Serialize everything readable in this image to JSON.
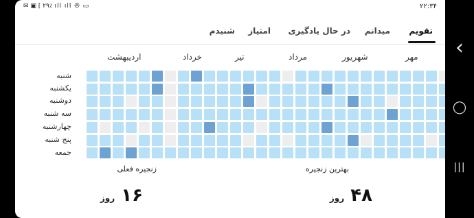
{
  "status": {
    "time": "۲۲:۳۴",
    "icons": "✉ ▣ ⁅ ۲۹٪ ıll ıll ✇ ▭"
  },
  "tabs": [
    {
      "label": "تقویم",
      "active": true
    },
    {
      "label": "میدانم",
      "active": false
    },
    {
      "label": "در حال یادگیری",
      "active": false
    },
    {
      "label": "امتیاز",
      "active": false
    },
    {
      "label": "شنیدم",
      "active": false
    }
  ],
  "months": [
    "مهر",
    "شهریور",
    "مرداد",
    "تیر",
    "خرداد",
    "اردیبهشت"
  ],
  "weekdays": [
    "شنبه",
    "یکشنبه",
    "دوشنبه",
    "سه شنبه",
    "چهارشنبه",
    "پنج شنبه",
    "جمعه"
  ],
  "activity_grid": [
    [
      1,
      1,
      1,
      1,
      1,
      3,
      0,
      1,
      3,
      1,
      1,
      1,
      1,
      1,
      1,
      0,
      1,
      1,
      1,
      1,
      1,
      1,
      1,
      1,
      1,
      1,
      1,
      0,
      1,
      1,
      1,
      1
    ],
    [
      1,
      1,
      1,
      1,
      1,
      3,
      0,
      1,
      1,
      1,
      1,
      1,
      3,
      1,
      1,
      1,
      1,
      1,
      3,
      1,
      1,
      1,
      1,
      1,
      1,
      1,
      1,
      1,
      1,
      1,
      1,
      0
    ],
    [
      1,
      1,
      1,
      0,
      1,
      1,
      0,
      1,
      1,
      1,
      1,
      1,
      3,
      0,
      1,
      1,
      1,
      1,
      1,
      1,
      3,
      1,
      1,
      0,
      1,
      1,
      1,
      1,
      1,
      1,
      1,
      0
    ],
    [
      1,
      1,
      1,
      1,
      1,
      1,
      0,
      1,
      1,
      1,
      1,
      1,
      1,
      1,
      1,
      1,
      1,
      1,
      1,
      1,
      1,
      1,
      1,
      3,
      1,
      1,
      1,
      1,
      1,
      1,
      1,
      0
    ],
    [
      1,
      0,
      1,
      1,
      0,
      1,
      0,
      1,
      1,
      3,
      1,
      1,
      1,
      0,
      1,
      1,
      1,
      1,
      3,
      1,
      1,
      1,
      1,
      1,
      1,
      1,
      1,
      1,
      1,
      1,
      1,
      0
    ],
    [
      1,
      1,
      1,
      0,
      1,
      1,
      0,
      1,
      1,
      1,
      1,
      1,
      0,
      1,
      1,
      0,
      1,
      1,
      1,
      1,
      3,
      0,
      1,
      1,
      1,
      1,
      0,
      1,
      1,
      1,
      1,
      0
    ],
    [
      1,
      3,
      1,
      3,
      1,
      1,
      1,
      1,
      1,
      1,
      1,
      1,
      1,
      1,
      1,
      1,
      1,
      1,
      1,
      1,
      1,
      1,
      1,
      1,
      1,
      1,
      1,
      1,
      1,
      1,
      1,
      0
    ]
  ],
  "best_streak": {
    "label": "بهترین زنجیره",
    "value": "۴۸",
    "unit": "روز"
  },
  "current_streak": {
    "label": "زنجیره فعلی",
    "value": "۱۶",
    "unit": "روز"
  },
  "nav": {
    "back": "‹",
    "home": "◯",
    "recents": "|||"
  }
}
